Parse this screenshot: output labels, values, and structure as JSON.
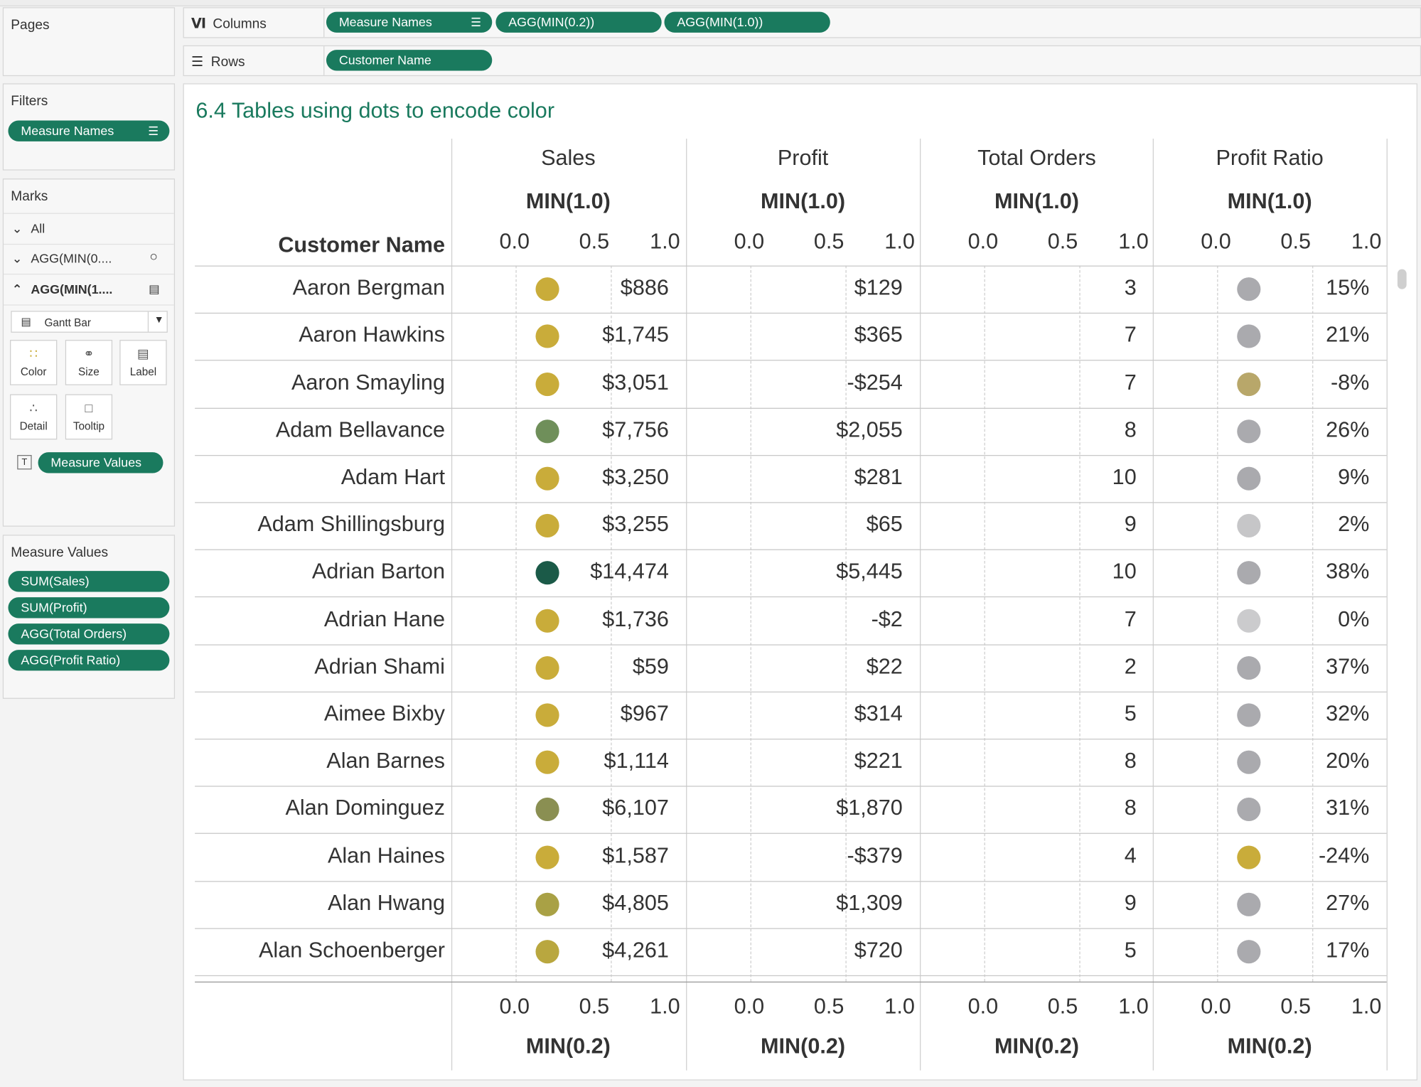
{
  "shelves": {
    "pages_label": "Pages",
    "columns_label": "Columns",
    "rows_label": "Rows",
    "columns_pills": [
      "Measure Names",
      "AGG(MIN(0.2))",
      "AGG(MIN(1.0))"
    ],
    "rows_pills": [
      "Customer Name"
    ]
  },
  "filters": {
    "title": "Filters",
    "pills": [
      "Measure Names"
    ]
  },
  "marks": {
    "title": "Marks",
    "rows": [
      "All",
      "AGG(MIN(0....",
      "AGG(MIN(1...."
    ],
    "mark_type": "Gantt Bar",
    "buttons": [
      "Color",
      "Size",
      "Label",
      "Detail",
      "Tooltip"
    ],
    "label_pill": "Measure Values"
  },
  "measure_values": {
    "title": "Measure Values",
    "pills": [
      "SUM(Sales)",
      "SUM(Profit)",
      "AGG(Total Orders)",
      "AGG(Profit Ratio)"
    ]
  },
  "viz": {
    "title": "6.4 Tables using dots to encode color",
    "row_header": "Customer Name",
    "columns": [
      "Sales",
      "Profit",
      "Total Orders",
      "Profit Ratio"
    ],
    "top_axis_label": "MIN(1.0)",
    "bottom_axis_label": "MIN(0.2)",
    "ticks": [
      "0.0",
      "0.5",
      "1.0"
    ],
    "rows": [
      {
        "name": "Aaron Bergman",
        "sales": "$886",
        "profit": "$129",
        "orders": "3",
        "ratio": "15%",
        "sales_color": "#c9ac3a",
        "ratio_color": "#aaaaae"
      },
      {
        "name": "Aaron Hawkins",
        "sales": "$1,745",
        "profit": "$365",
        "orders": "7",
        "ratio": "21%",
        "sales_color": "#c9ac3a",
        "ratio_color": "#aaaaae"
      },
      {
        "name": "Aaron Smayling",
        "sales": "$3,051",
        "profit": "-$254",
        "orders": "7",
        "ratio": "-8%",
        "sales_color": "#c9ac3a",
        "ratio_color": "#b8a76a"
      },
      {
        "name": "Adam Bellavance",
        "sales": "$7,756",
        "profit": "$2,055",
        "orders": "8",
        "ratio": "26%",
        "sales_color": "#6f8f5a",
        "ratio_color": "#aaaaae"
      },
      {
        "name": "Adam Hart",
        "sales": "$3,250",
        "profit": "$281",
        "orders": "10",
        "ratio": "9%",
        "sales_color": "#c9ac3a",
        "ratio_color": "#aaaaae"
      },
      {
        "name": "Adam Shillingsburg",
        "sales": "$3,255",
        "profit": "$65",
        "orders": "9",
        "ratio": "2%",
        "sales_color": "#c9ac3a",
        "ratio_color": "#c6c6c8"
      },
      {
        "name": "Adrian Barton",
        "sales": "$14,474",
        "profit": "$5,445",
        "orders": "10",
        "ratio": "38%",
        "sales_color": "#1b5a48",
        "ratio_color": "#aaaaae"
      },
      {
        "name": "Adrian Hane",
        "sales": "$1,736",
        "profit": "-$2",
        "orders": "7",
        "ratio": "0%",
        "sales_color": "#c9ac3a",
        "ratio_color": "#cbcbcd"
      },
      {
        "name": "Adrian Shami",
        "sales": "$59",
        "profit": "$22",
        "orders": "2",
        "ratio": "37%",
        "sales_color": "#c9ac3a",
        "ratio_color": "#aaaaae"
      },
      {
        "name": "Aimee Bixby",
        "sales": "$967",
        "profit": "$314",
        "orders": "5",
        "ratio": "32%",
        "sales_color": "#c9ac3a",
        "ratio_color": "#aaaaae"
      },
      {
        "name": "Alan Barnes",
        "sales": "$1,114",
        "profit": "$221",
        "orders": "8",
        "ratio": "20%",
        "sales_color": "#c9ac3a",
        "ratio_color": "#aaaaae"
      },
      {
        "name": "Alan Dominguez",
        "sales": "$6,107",
        "profit": "$1,870",
        "orders": "8",
        "ratio": "31%",
        "sales_color": "#8a8f52",
        "ratio_color": "#aaaaae"
      },
      {
        "name": "Alan Haines",
        "sales": "$1,587",
        "profit": "-$379",
        "orders": "4",
        "ratio": "-24%",
        "sales_color": "#c9ac3a",
        "ratio_color": "#c9ac3a"
      },
      {
        "name": "Alan Hwang",
        "sales": "$4,805",
        "profit": "$1,309",
        "orders": "9",
        "ratio": "27%",
        "sales_color": "#a9a145",
        "ratio_color": "#aaaaae"
      },
      {
        "name": "Alan Schoenberger",
        "sales": "$4,261",
        "profit": "$720",
        "orders": "5",
        "ratio": "17%",
        "sales_color": "#b9a73f",
        "ratio_color": "#aaaaae"
      }
    ]
  },
  "colors": {
    "pill": "#1a7a5e",
    "title": "#1a7a5e"
  }
}
